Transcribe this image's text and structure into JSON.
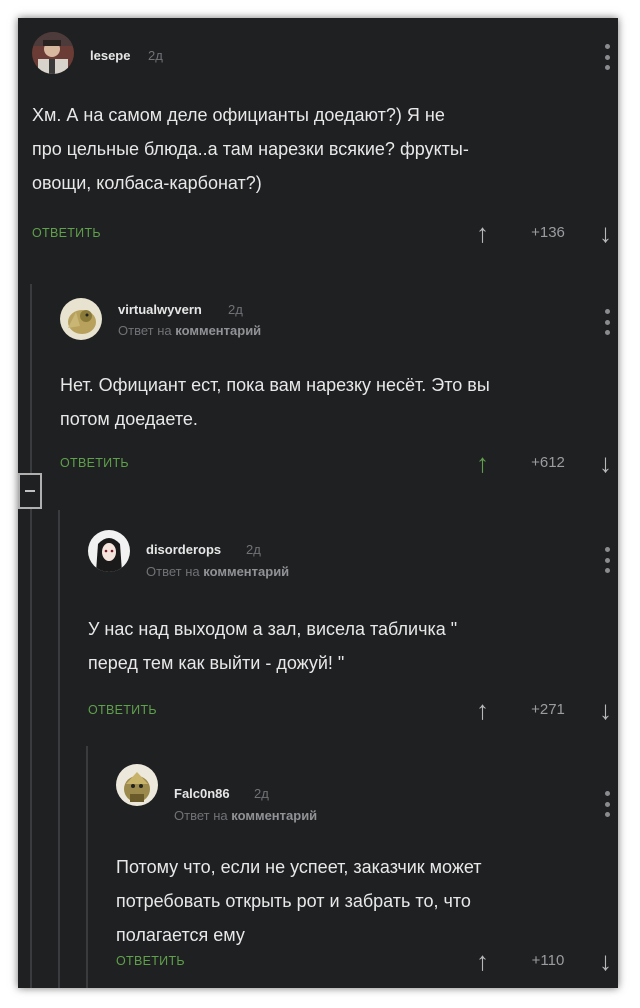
{
  "reply_label": "ОТВЕТИТЬ",
  "reply_to_prefix": "Ответ на",
  "reply_to_word": "комментарий",
  "comments": [
    {
      "user": "lesepe",
      "time": "2д",
      "text": "Хм. А на самом деле официанты доедают?) Я не\nпро цельные блюда..а там нарезки всякие? фрукты-\nовощи, колбаса-карбонат?)",
      "score": "+136",
      "upvoted": false
    },
    {
      "user": "virtualwyvern",
      "time": "2д",
      "text": "Нет. Официант ест, пока вам нарезку несёт. Это вы\nпотом доедаете.",
      "score": "+612",
      "upvoted": true
    },
    {
      "user": "disorderops",
      "time": "2д",
      "text": "У нас над выходом а зал, висела табличка \"\nперед тем как выйти - дожуй! \"",
      "score": "+271",
      "upvoted": false
    },
    {
      "user": "Falc0n86",
      "time": "2д",
      "text": "Потому что, если не успеет, заказчик может\nпотребовать открыть рот и забрать то, что\nполагается ему",
      "score": "+110",
      "upvoted": false
    }
  ],
  "icons": {
    "upvote": "arrow-up",
    "downvote": "arrow-down",
    "more": "vertical-dots",
    "collapse": "minus-box"
  }
}
